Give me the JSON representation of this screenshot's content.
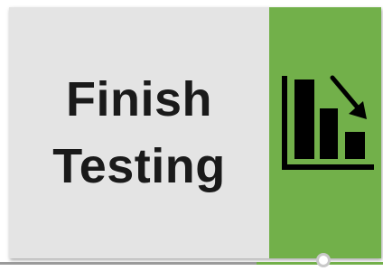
{
  "step": {
    "title_line1": "Finish",
    "title_line2": "Testing",
    "icon": "bar-chart-decreasing-icon"
  },
  "colors": {
    "label_background": "#e4e4e4",
    "accent": "#72b04a",
    "text": "#1a1a1a",
    "track": "#9a9a9a"
  }
}
